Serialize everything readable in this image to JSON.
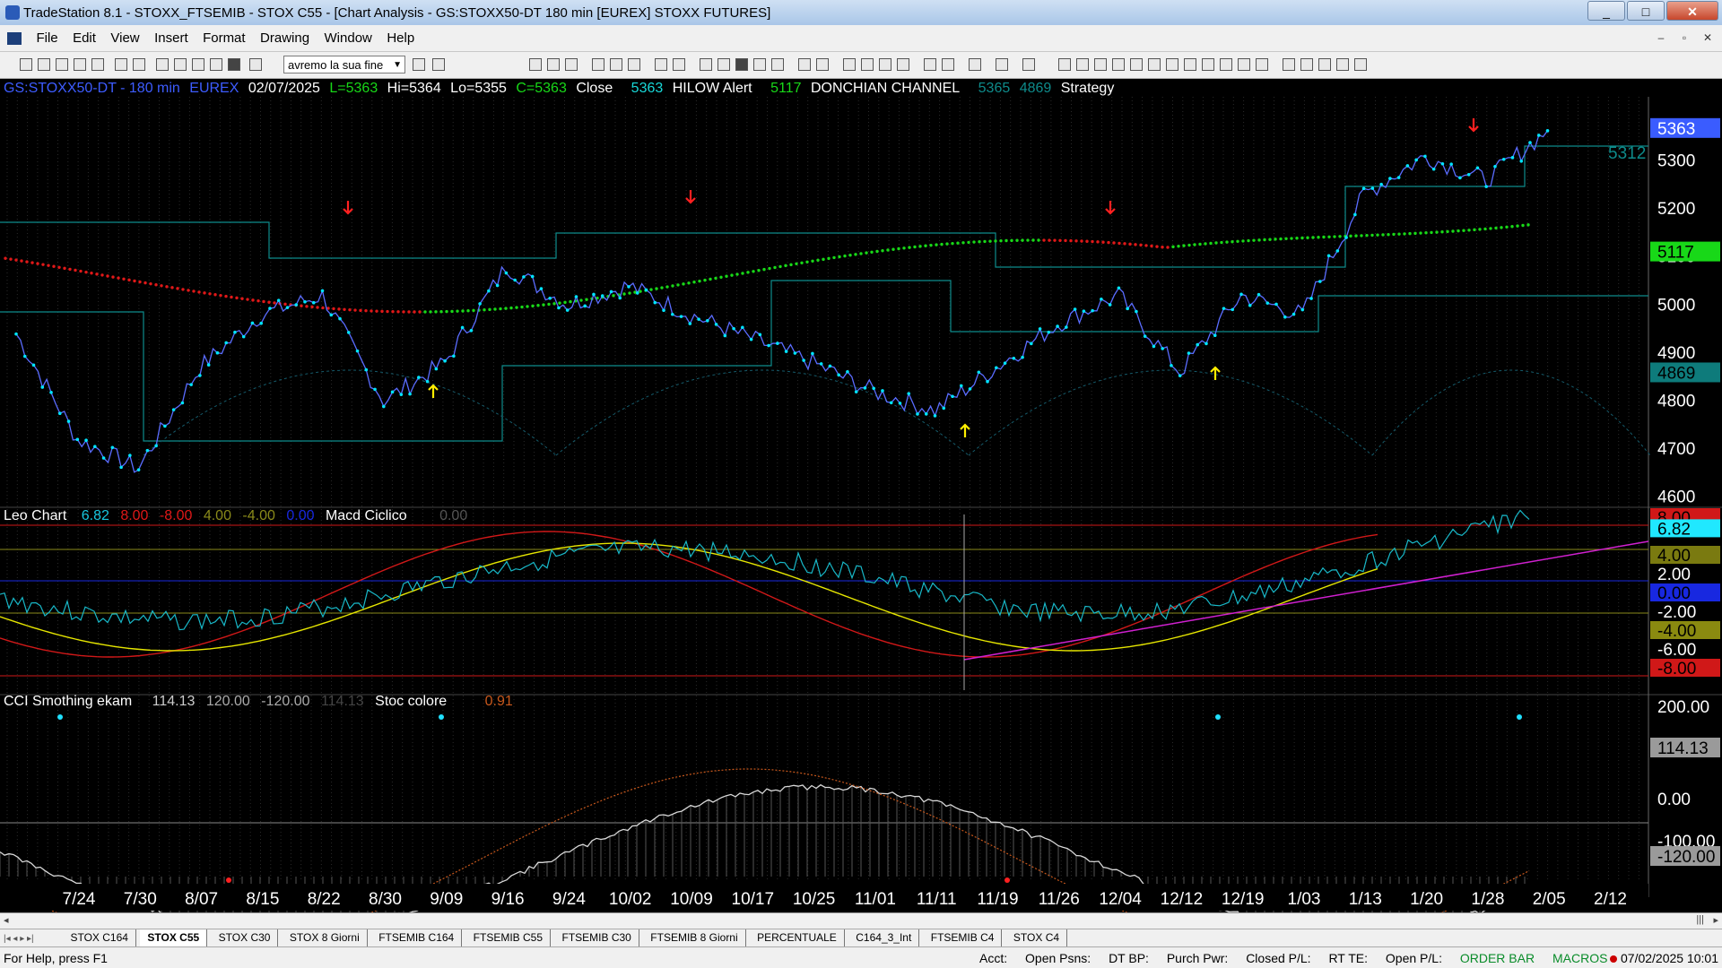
{
  "window": {
    "title": "TradeStation 8.1 - STOXX_FTSEMIB - STOX C55 - [Chart Analysis - GS:STOXX50-DT  180 min  [EUREX] STOXX FUTURES]",
    "minimize": "_",
    "maximize": "□",
    "close": "✕"
  },
  "menu": {
    "items": [
      "File",
      "Edit",
      "View",
      "Insert",
      "Format",
      "Drawing",
      "Window",
      "Help"
    ],
    "mdi_minimize": "–",
    "mdi_restore": "▫",
    "mdi_close": "✕"
  },
  "toolbar": {
    "dropdown_value": "avremo la sua fine"
  },
  "header": {
    "symbol": "GS:STOXX50-DT - 180 min",
    "exchange": "EUREX",
    "date": "02/07/2025",
    "last": "L=5363",
    "high": "Hi=5364",
    "low": "Lo=5355",
    "close": "C=5363",
    "close_label": "Close",
    "close_value": "5363",
    "hilow_label": "HILOW Alert",
    "donchian_value": "5117",
    "donchian_label": "DONCHIAN CHANNEL",
    "donchian_v1": "5365",
    "donchian_v2": "4869",
    "strategy_label": "Strategy"
  },
  "leo": {
    "label": "Leo Chart",
    "v1": "6.82",
    "v2": "8.00",
    "v3": "-8.00",
    "v4": "4.00",
    "v5": "-4.00",
    "v6": "0.00",
    "macd_label": "Macd Ciclico",
    "macd_value": "0.00"
  },
  "cci": {
    "label": "CCI Smothing ekam",
    "v1": "114.13",
    "v2": "120.00",
    "v3": "-120.00",
    "v4": "114.13",
    "stoc_label": "Stoc colore",
    "stoc_value": "0.91"
  },
  "price_axis": {
    "ticks": [
      "5300",
      "5200",
      "5100",
      "5000",
      "4900",
      "4800",
      "4700",
      "4600"
    ],
    "last_tag": "5363",
    "donchian_tag": "5117",
    "lower_tag": "4869",
    "level_label": "5312"
  },
  "leo_axis": {
    "ticks": [
      "8.00",
      "6.82",
      "4.00",
      "2.00",
      "0.00",
      "-2.00",
      "-4.00",
      "-6.00",
      "-8.00"
    ]
  },
  "cci_axis": {
    "ticks": [
      "200.00",
      "114.13",
      "0.00",
      "-100.00",
      "-120.00"
    ]
  },
  "dates": [
    "7/24",
    "7/30",
    "8/07",
    "8/15",
    "8/22",
    "8/30",
    "9/09",
    "9/16",
    "9/24",
    "10/02",
    "10/09",
    "10/17",
    "10/25",
    "11/01",
    "11/11",
    "11/19",
    "11/26",
    "12/04",
    "12/12",
    "12/19",
    "1/03",
    "1/13",
    "1/20",
    "1/28",
    "2/05",
    "2/12"
  ],
  "tabs": [
    "STOX C164",
    "STOX C55",
    "STOX  C30",
    "STOX  8 Giorni",
    "FTSEMIB C164",
    "FTSEMIB C55",
    "FTSEMIB C30",
    "FTSEMIB  8 Giorni",
    "PERCENTUALE",
    "C164_3_Int",
    "FTSEMIB C4",
    "STOX  C4"
  ],
  "active_tab": "STOX C55",
  "tab_nav": "|◂ ◂ ▸ ▸|",
  "status": {
    "help": "For Help, press F1",
    "acct": "Acct:",
    "open_psns": "Open Psns:",
    "dt_bp": "DT BP:",
    "purch_pwr": "Purch Pwr:",
    "closed_pl": "Closed P/L:",
    "rt_te": "RT TE:",
    "open_pl": "Open P/L:",
    "order_bar": "ORDER BAR",
    "macros": "MACROS",
    "datetime": "07/02/2025 10:01"
  },
  "colors": {
    "price": "#5a6cff",
    "bar_dot": "#00e5ff",
    "donchian": "#0e8b8b",
    "ma_down": "#e01818",
    "ma_up": "#18d818",
    "leo_cyan": "#18b8c8",
    "leo_red": "#d01818",
    "leo_yellow": "#e6e600",
    "trend": "#d020d0",
    "cci_gray": "#d8d8d8",
    "stoc": "#c8581c"
  },
  "chart_data": {
    "type": "line",
    "x_labels": [
      "7/24",
      "7/30",
      "8/07",
      "8/15",
      "8/22",
      "8/30",
      "9/09",
      "9/16",
      "9/24",
      "10/02",
      "10/09",
      "10/17",
      "10/25",
      "11/01",
      "11/11",
      "11/19",
      "11/26",
      "12/04",
      "12/12",
      "12/19",
      "1/03",
      "1/13",
      "1/20",
      "1/28",
      "2/05",
      "2/12"
    ],
    "series": [
      {
        "name": "Close",
        "values": [
          4940,
          4720,
          4660,
          4870,
          4980,
          5020,
          4800,
          4880,
          5080,
          5000,
          5040,
          4980,
          4930,
          4880,
          4820,
          4780,
          4870,
          4960,
          5020,
          4860,
          5020,
          4980,
          5230,
          5310,
          5260,
          5363
        ]
      }
    ],
    "ylim": [
      4560,
      5400
    ]
  }
}
